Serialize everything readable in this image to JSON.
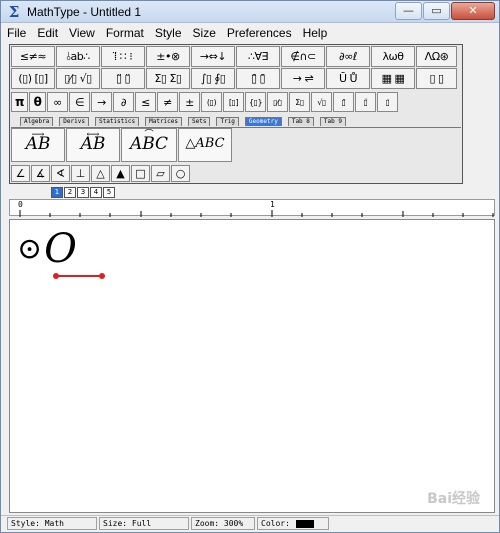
{
  "window": {
    "title": "MathType - Untitled 1",
    "app_icon": "sigma-icon"
  },
  "menu": [
    "File",
    "Edit",
    "View",
    "Format",
    "Style",
    "Size",
    "Preferences",
    "Help"
  ],
  "palette_row1": [
    "≤≠≈",
    "⫰ab∴",
    "⁞̈ ∷ ⁝",
    "±•⊗",
    "→⇔↓",
    "∴∀∃",
    "∉∩⊂",
    "∂∞ℓ",
    "λωθ",
    "ΛΩ⊛"
  ],
  "palette_row2": [
    "(▯) [▯]",
    "▯⁄▯ √▯",
    "▯̈ ▯̈",
    "Σ▯ Σ▯",
    "∫▯ ∮▯",
    "▯̄ ▯̄",
    "→ ⇌",
    "Ū Ů",
    "▦ ▦",
    "▯ ▯"
  ],
  "palette_row3": [
    "π",
    "θ",
    "∞",
    "∈",
    "→",
    "∂",
    "≤",
    "≠",
    "±",
    "(▯)",
    "[▯]",
    "{▯}",
    "▯⁄▯",
    "Σ▯",
    "√▯",
    "▯̄",
    "▯̈",
    "▯̇"
  ],
  "tabs": [
    "Algebra",
    "Derivs",
    "Statistics",
    "Matrices",
    "Sets",
    "Trig",
    "Geometry",
    "Tab 8",
    "Tab 9"
  ],
  "active_tab": "Geometry",
  "templates": [
    {
      "label": "AB",
      "over": "⟶"
    },
    {
      "label": "AB",
      "over": "⟷"
    },
    {
      "label": "ABC",
      "over": "⌒"
    },
    {
      "label": "△ABC",
      "over": ""
    }
  ],
  "shapes": [
    "∠",
    "∡",
    "∢",
    "⊥",
    "△",
    "▲",
    "□",
    "▱",
    "○"
  ],
  "mini_tabs": [
    "1",
    "2",
    "3",
    "4",
    "5"
  ],
  "ruler": {
    "marks": [
      "0",
      "1"
    ]
  },
  "equation": {
    "symbol": "⊙",
    "letter": "O"
  },
  "watermark": "Bai经验",
  "status": {
    "style": "Style: Math",
    "size": "Size: Full",
    "zoom": "Zoom: 300%",
    "color_label": "Color:",
    "color_value": "#000000"
  },
  "colors": {
    "accent": "#3a78d8",
    "annotation": "#e02020"
  }
}
